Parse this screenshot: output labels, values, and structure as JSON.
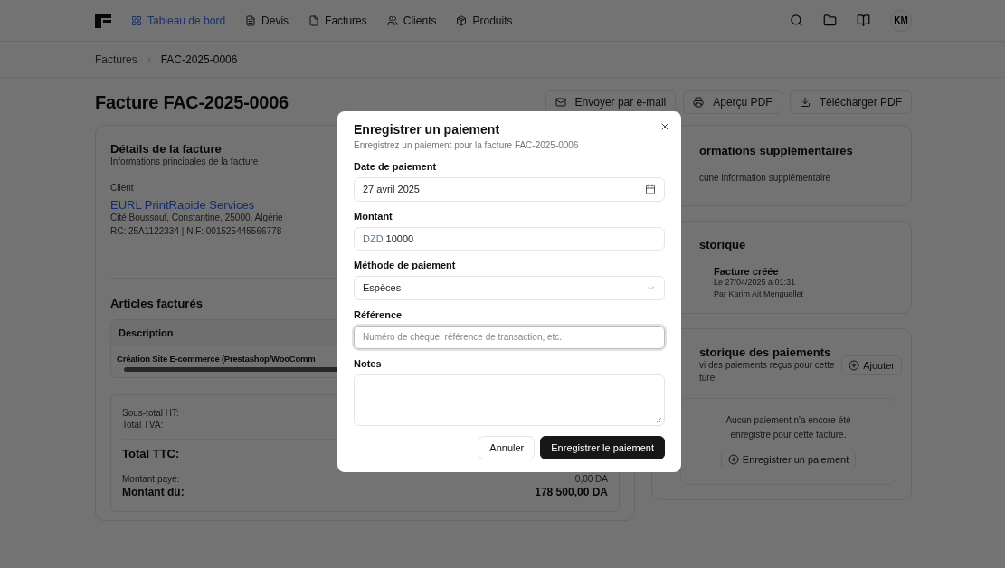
{
  "nav": {
    "items": [
      {
        "label": "Tableau de bord",
        "selected": true
      },
      {
        "label": "Devis",
        "selected": false
      },
      {
        "label": "Factures",
        "selected": false
      },
      {
        "label": "Clients",
        "selected": false
      },
      {
        "label": "Produits",
        "selected": false
      }
    ],
    "avatar": "KM"
  },
  "breadcrumb": [
    "Factures",
    "FAC-2025-0006"
  ],
  "page": {
    "title": "Facture FAC-2025-0006",
    "actions": [
      {
        "label": "Envoyer par e-mail"
      },
      {
        "label": "Aperçu PDF"
      },
      {
        "label": "Télécharger PDF"
      }
    ]
  },
  "details": {
    "title": "Détails de la facture",
    "subtitle": "Informations principales de la facture",
    "client_label": "Client",
    "client_name": "EURL PrintRapide Services",
    "address": "Cité Boussouf, Constantine, 25000, Algérie",
    "ids": "RC: 25A1122334 | NIF: 001525445566778"
  },
  "items": {
    "title": "Articles facturés",
    "columns": [
      "Description"
    ],
    "rows": [
      [
        "Création Site E-commerce (Prestashop/WooComm"
      ]
    ]
  },
  "totals": [
    {
      "label": "Sous-total HT:",
      "kind": "small"
    },
    {
      "label": "Total TVA:",
      "kind": "small"
    },
    {
      "label": "Total TTC:",
      "kind": "total"
    },
    {
      "label": "Montant payé:",
      "value": "0,00 DA",
      "kind": "small"
    },
    {
      "label": "Montant dû:",
      "value": "178 500,00 DA",
      "kind": "due"
    }
  ],
  "extra_info": {
    "title": "ormations supplémentaires",
    "text": "cune information supplémentaire"
  },
  "history": {
    "title": "storique",
    "events": [
      {
        "title": "Facture créée",
        "date": "Le 27/04/2025 à 01:31",
        "author": "Par Karim Ait Menguellet"
      }
    ]
  },
  "payments": {
    "title": "storique des paiements",
    "subtitle_lines": [
      "vi des paiements reçus pour cette",
      "ture"
    ],
    "add_button": "Ajouter",
    "empty_text": "Aucun paiement n'a encore été enregistré pour cette facture.",
    "record_button": "Enregistrer un paiement"
  },
  "dialog": {
    "title": "Enregistrer un paiement",
    "description": "Enregistrez un paiement pour la facture FAC-2025-0006",
    "fields": [
      {
        "label": "Date de paiement",
        "kind": "date",
        "value": "27 avril 2025",
        "focused": false
      },
      {
        "label": "Montant",
        "kind": "amount",
        "prefix": "DZD",
        "value": "10000",
        "focused": false
      },
      {
        "label": "Méthode de paiement",
        "kind": "select",
        "value": "Espèces",
        "focused": false
      },
      {
        "label": "Référence",
        "kind": "text",
        "placeholder": "Numéro de chèque, référence de transaction, etc.",
        "focused": true
      },
      {
        "label": "Notes",
        "kind": "textarea",
        "focused": false
      }
    ],
    "buttons": [
      {
        "label": "Annuler",
        "kind": "secondary"
      },
      {
        "label": "Enregistrer le paiement",
        "kind": "primary"
      }
    ]
  }
}
